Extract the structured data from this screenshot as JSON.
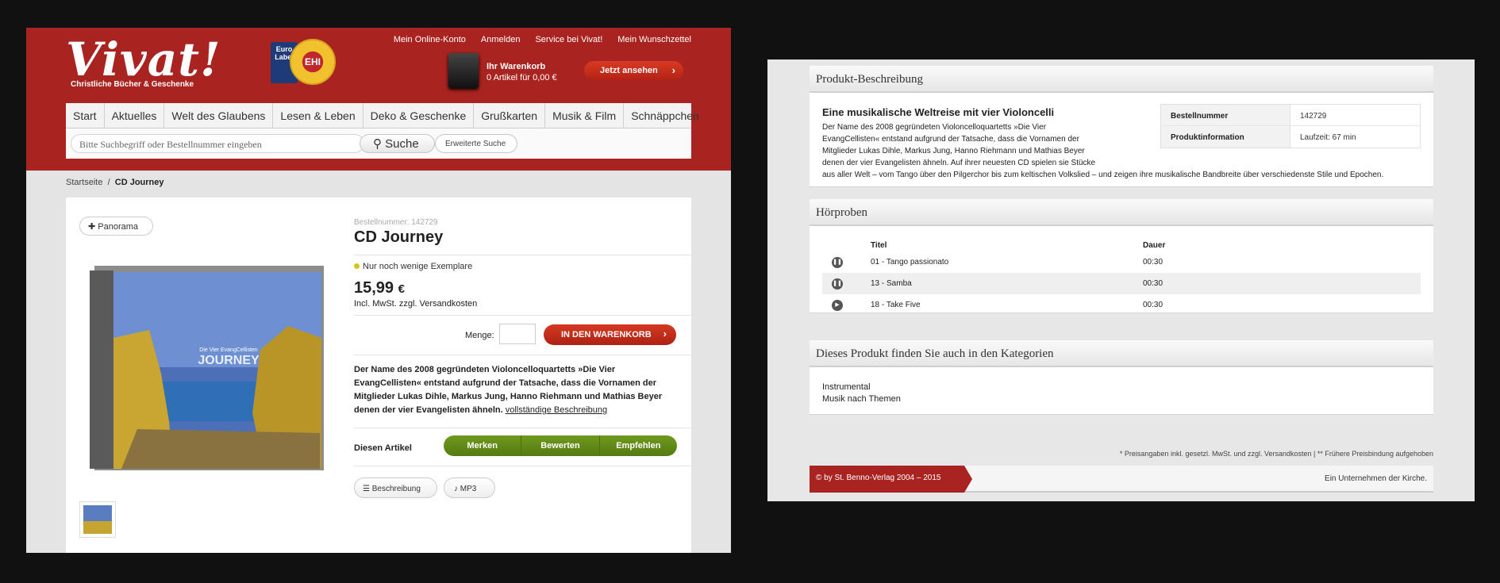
{
  "header": {
    "logo_text": "Vivat!",
    "logo_subtitle": "Christliche Bücher & Geschenke",
    "label_badge": "Euro Label",
    "seal_text": "EHI",
    "top_links": [
      "Mein Online-Konto",
      "Anmelden",
      "Service bei Vivat!",
      "Mein Wunschzettel"
    ],
    "cart_title": "Ihr Warenkorb",
    "cart_summary": "0 Artikel für 0,00 €",
    "cart_button": "Jetzt ansehen"
  },
  "nav": [
    "Start",
    "Aktuelles",
    "Welt des Glaubens",
    "Lesen & Leben",
    "Deko & Geschenke",
    "Grußkarten",
    "Musik & Film",
    "Schnäppchen"
  ],
  "search": {
    "placeholder": "Bitte Suchbegriff oder Bestellnummer eingeben",
    "button": "Suche",
    "advanced": "Erweiterte Suche"
  },
  "breadcrumb": {
    "home": "Startseite",
    "sep": "/",
    "current": "CD Journey"
  },
  "product": {
    "panorama_button": "Panorama",
    "cover_band": "Die Vier EvangCellisten",
    "cover_title": "JOURNEY",
    "order_number": "Bestellnummer: 142729",
    "title": "CD Journey",
    "availability": "Nur noch wenige Exemplare",
    "price": "15,99",
    "currency": "€",
    "vat_note": "Incl. MwSt. zzgl. Versandkosten",
    "quantity_label": "Menge:",
    "quantity_value": "",
    "add_to_cart": "IN DEN WARENKORB",
    "description": "Der Name des 2008 gegründeten Violoncelloquartetts »Die Vier EvangCellisten« entstand aufgrund der Tatsache, dass die Vornamen der Mitglieder Lukas Dihle, Markus Jung, Hanno Riehmann und Mathias Beyer denen der vier Evangelisten ähneln.",
    "full_description_link": "vollständige Beschreibung",
    "article_label": "Diesen Artikel",
    "article_actions": [
      "Merken",
      "Bewerten",
      "Empfehlen"
    ],
    "tabs": [
      "Beschreibung",
      "MP3"
    ]
  },
  "description_section": {
    "heading": "Produkt-Beschreibung",
    "title": "Eine musikalische Weltreise mit vier Violoncelli",
    "text_lines": [
      "Der Name des 2008 gegründeten Violoncelloquartetts »Die Vier",
      "EvangCellisten« entstand aufgrund der Tatsache, dass die Vornamen der",
      "Mitglieder Lukas Dihle, Markus Jung, Hanno Riehmann und Mathias Beyer",
      "denen der vier Evangelisten ähneln. Auf ihrer neuesten CD spielen sie Stücke",
      "aus aller Welt – vom Tango über den Pilgerchor bis zum keltischen Volkslied – und zeigen ihre musikalische Bandbreite über verschiedenste Stile und Epochen."
    ],
    "specs": [
      {
        "key": "Bestellnummer",
        "value": "142729"
      },
      {
        "key": "Produktinformation",
        "value": "Laufzeit: 67 min"
      }
    ]
  },
  "samples": {
    "heading": "Hörproben",
    "col_title": "Titel",
    "col_duration": "Dauer",
    "tracks": [
      {
        "title": "01 - Tango passionato",
        "duration": "00:30",
        "icon": "pause-icon"
      },
      {
        "title": "13 - Samba",
        "duration": "00:30",
        "icon": "pause-icon"
      },
      {
        "title": "18 - Take Five",
        "duration": "00:30",
        "icon": "play-icon"
      }
    ]
  },
  "categories": {
    "heading": "Dieses Produkt finden Sie auch in den Kategorien",
    "items": [
      "Instrumental",
      "Musik nach Themen"
    ]
  },
  "footer": {
    "footnote": "* Preisangaben inkl. gesetzl. MwSt. und zzgl. Versandkosten | ** Frühere Preisbindung aufgehoben",
    "copyright": "© by St. Benno-Verlag 2004 – 2015",
    "tagline": "Ein Unternehmen der Kirche."
  },
  "colors": {
    "brand_red": "#a92320",
    "action_green": "#5f8a17",
    "availability_yellow": "#d4c618"
  }
}
